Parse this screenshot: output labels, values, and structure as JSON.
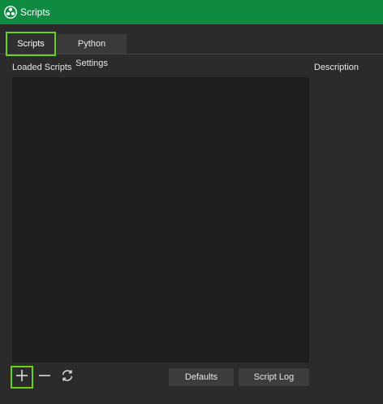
{
  "window": {
    "title": "Scripts",
    "app_icon": "obs-logo-icon"
  },
  "tabs": [
    {
      "label": "Scripts",
      "active": true
    },
    {
      "label": "Python Settings",
      "active": false
    }
  ],
  "main": {
    "loaded_label": "Loaded Scripts",
    "description_label": "Description",
    "scripts": []
  },
  "toolbar": {
    "add_icon": "plus-icon",
    "remove_icon": "minus-icon",
    "reload_icon": "reload-icon",
    "defaults_label": "Defaults",
    "script_log_label": "Script Log"
  },
  "colors": {
    "titlebar": "#0e8a41",
    "highlight": "#6ad414",
    "list_bg": "#1f1f1f",
    "window_bg": "#2b2b2b"
  }
}
